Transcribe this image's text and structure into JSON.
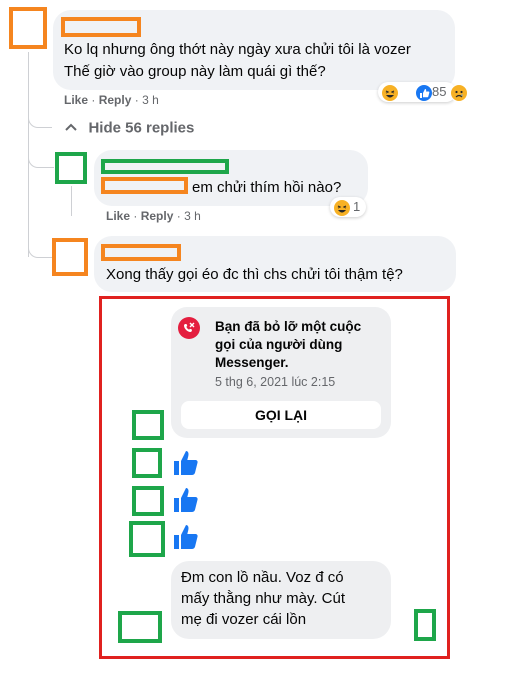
{
  "comments": {
    "c1": {
      "text_line1": "Ko lq nhưng ông thớt này ngày xưa chửi tôi là vozer",
      "text_line2": "Thế giờ vào group này làm quái gì thế?",
      "like_label": "Like",
      "reply_label": "Reply",
      "time": "3 h",
      "reaction_count": "85"
    },
    "hide_replies_label": "Hide 56 replies",
    "c2": {
      "text": "em chửi thím hồi nào?",
      "like_label": "Like",
      "reply_label": "Reply",
      "time": "3 h",
      "reaction_count": "1"
    },
    "c3": {
      "text": "Xong thấy gọi éo đc thì chs chửi tôi thậm tệ?"
    }
  },
  "messenger": {
    "missed_call_title": "Bạn đã bỏ lỡ một cuộc gọi của người dùng Messenger.",
    "missed_call_line1": "Bạn đã bỏ lỡ một cuộc",
    "missed_call_line2": "gọi của người dùng",
    "missed_call_line3": "Messenger.",
    "missed_call_date": "5 thg 6, 2021 lúc 2:15",
    "call_back_label": "GỌI LẠI",
    "last_msg_line1": "Đm con lồ nầu. Voz đ có",
    "last_msg_line2": "mấy thằng như mày. Cút",
    "last_msg_line3": "mẹ đi vozer cái lồn"
  },
  "colors": {
    "redact_orange": "#f5851f",
    "redact_green": "#1ea64a",
    "frame_red": "#e0211f",
    "like_blue": "#1877f2",
    "missed_call_red": "#e41e3f"
  }
}
